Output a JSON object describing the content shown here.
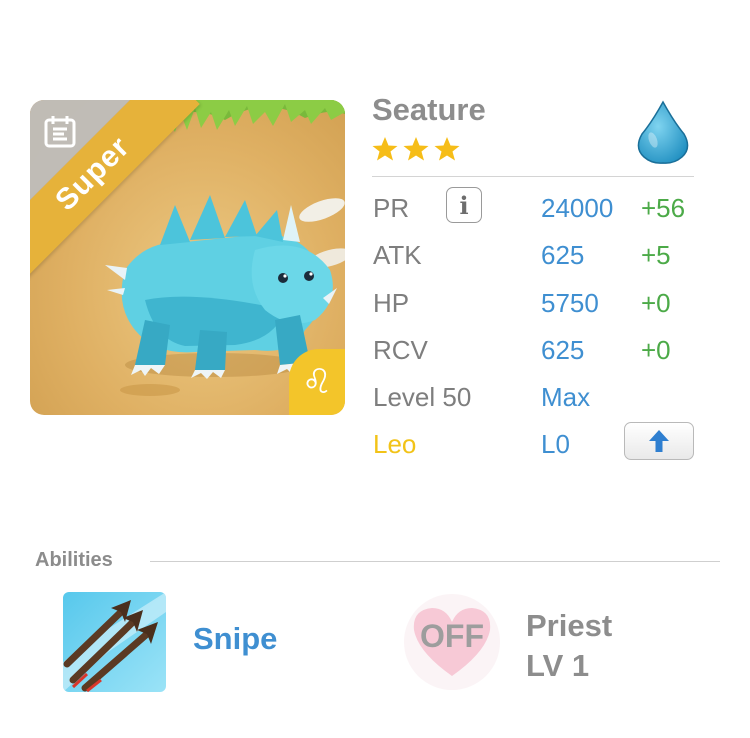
{
  "monster": {
    "rarity_label": "Super",
    "name": "Seature",
    "stars": 3,
    "element_icon": "water-drop-icon",
    "zodiac_symbol": "♌",
    "colors": {
      "element": "#3aa6d6",
      "rarity_ribbon": "#e6b23a",
      "zodiac": "#f3c52a"
    }
  },
  "stats": {
    "pr": {
      "label": "PR",
      "value": "24000",
      "bonus": "+56"
    },
    "atk": {
      "label": "ATK",
      "value": "625",
      "bonus": "+5"
    },
    "hp": {
      "label": "HP",
      "value": "5750",
      "bonus": "+0"
    },
    "rcv": {
      "label": "RCV",
      "value": "625",
      "bonus": "+0"
    },
    "level": {
      "label": "Level 50",
      "value": "Max"
    },
    "zodiac": {
      "label": "Leo",
      "value": "L0"
    }
  },
  "info_button": {
    "glyph": "i"
  },
  "abilities": {
    "section_label": "Abilities",
    "skill": {
      "name": "Snipe",
      "icon": "arrows-icon"
    },
    "leader": {
      "status": "OFF",
      "name": "Priest",
      "level": "LV 1",
      "icon": "heart-icon"
    }
  },
  "text_colors": {
    "value_blue": "#3f8fd1",
    "bonus_green": "#4caa48",
    "label_gray": "#7e7e7e",
    "zodiac_yellow": "#f2c318"
  }
}
